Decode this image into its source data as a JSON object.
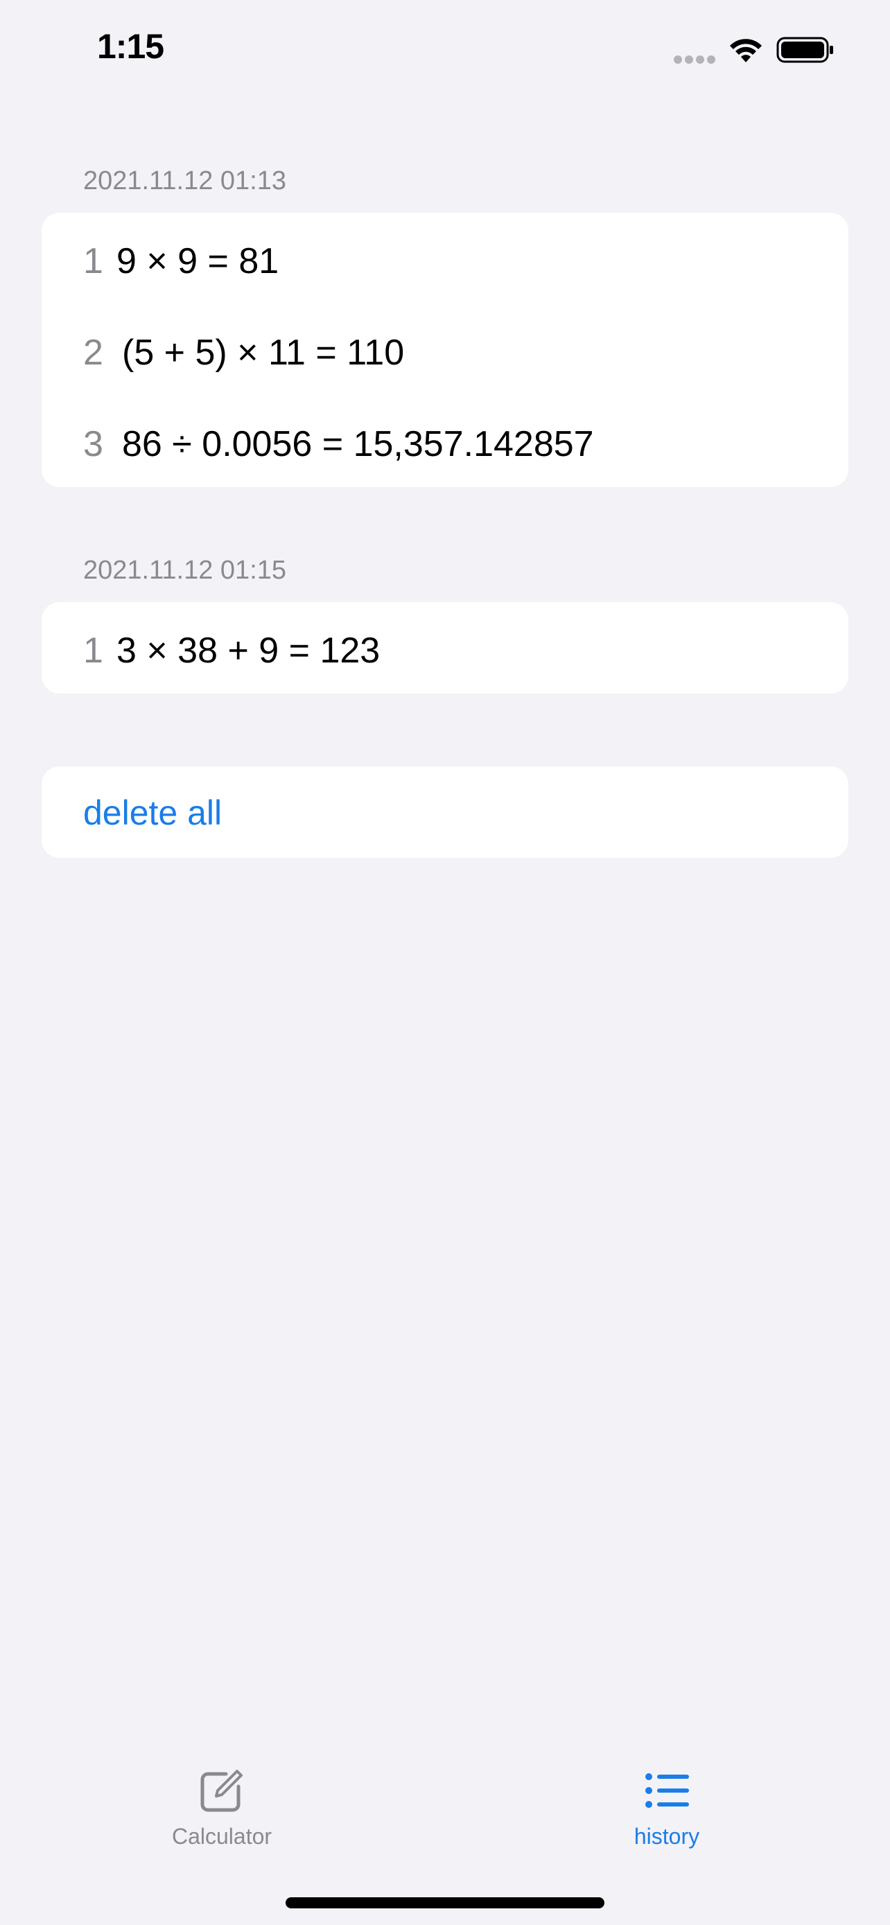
{
  "status_bar": {
    "time": "1:15",
    "signal_icon": "cellular-dots-icon",
    "wifi_icon": "wifi-icon",
    "battery_icon": "battery-full-icon"
  },
  "history": {
    "sections": [
      {
        "header": "2021.11.12 01:13",
        "entries": [
          {
            "index": "1",
            "expression": "9 × 9 = 81"
          },
          {
            "index": "2",
            "expression": "(5 + 5) × 11 = 110"
          },
          {
            "index": "3",
            "expression": "86 ÷ 0.0056 = 15,357.142857"
          }
        ]
      },
      {
        "header": "2021.11.12 01:15",
        "entries": [
          {
            "index": "1",
            "expression": "3 × 38 + 9 = 123"
          }
        ]
      }
    ],
    "delete_all_label": "delete all"
  },
  "tab_bar": {
    "tabs": [
      {
        "label": "Calculator",
        "icon": "square-pencil-icon",
        "selected": false
      },
      {
        "label": "history",
        "icon": "list-bullet-icon",
        "selected": true
      }
    ]
  },
  "colors": {
    "accent": "#1a7de8",
    "background": "#f2f2f7",
    "secondary_text": "#8a8a8e",
    "card": "#ffffff"
  }
}
